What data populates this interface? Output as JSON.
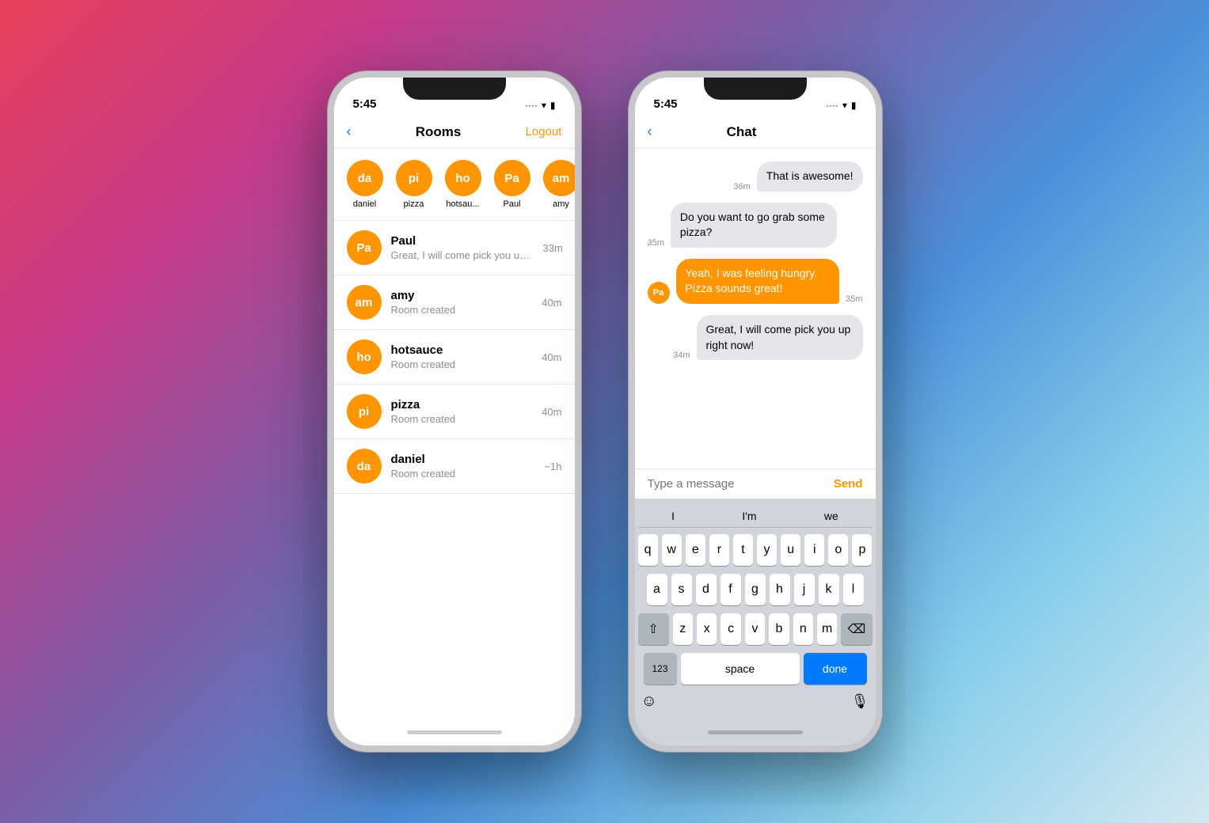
{
  "background": {
    "gradient": "linear-gradient(135deg, #e8405a 0%, #c53b8a 20%, #7b5ea7 40%, #4a90d9 60%, #87ceeb 80%, #d4e8f0 100%)"
  },
  "phone1": {
    "status_time": "5:45",
    "nav_back": "‹",
    "nav_title": "Rooms",
    "nav_action": "Logout",
    "avatars": [
      {
        "initials": "da",
        "label": "daniel"
      },
      {
        "initials": "pi",
        "label": "pizza"
      },
      {
        "initials": "ho",
        "label": "hotsau..."
      },
      {
        "initials": "Pa",
        "label": "Paul"
      },
      {
        "initials": "am",
        "label": "amy"
      }
    ],
    "rooms": [
      {
        "initials": "Pa",
        "name": "Paul",
        "preview": "Great, I will come pick you up right ...",
        "time": "33m"
      },
      {
        "initials": "am",
        "name": "amy",
        "preview": "Room created",
        "time": "40m"
      },
      {
        "initials": "ho",
        "name": "hotsauce",
        "preview": "Room created",
        "time": "40m"
      },
      {
        "initials": "pi",
        "name": "pizza",
        "preview": "Room created",
        "time": "40m"
      },
      {
        "initials": "da",
        "name": "daniel",
        "preview": "Room created",
        "time": "~1h"
      }
    ]
  },
  "phone2": {
    "status_time": "5:45",
    "nav_back": "‹",
    "nav_title": "Chat",
    "messages": [
      {
        "type": "sent",
        "text": "That is awesome!",
        "time": "36m"
      },
      {
        "type": "received",
        "text": "Do you want to go grab some pizza?",
        "time": "35m"
      },
      {
        "type": "sent_other",
        "initials": "Pa",
        "text": "Yeah, I was feeling hungry. Pizza sounds great!",
        "time": "35m"
      },
      {
        "type": "received_right",
        "text": "Great, I will come pick you up right now!",
        "time": "34m"
      }
    ],
    "input_placeholder": "Type a message",
    "send_label": "Send",
    "keyboard": {
      "suggestions": [
        "I",
        "I'm",
        "we"
      ],
      "rows": [
        [
          "q",
          "w",
          "e",
          "r",
          "t",
          "y",
          "u",
          "i",
          "o",
          "p"
        ],
        [
          "a",
          "s",
          "d",
          "f",
          "g",
          "h",
          "j",
          "k",
          "l"
        ],
        [
          "z",
          "x",
          "c",
          "v",
          "b",
          "n",
          "m"
        ],
        [
          "123",
          "space",
          "done"
        ]
      ],
      "emoji_icon": "☺",
      "mic_icon": "🎙"
    }
  }
}
